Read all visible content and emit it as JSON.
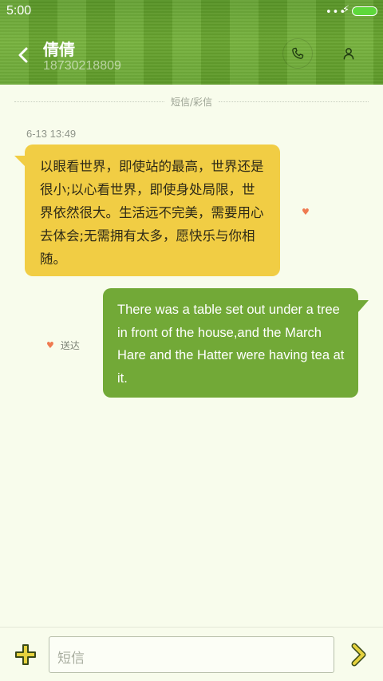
{
  "status_bar": {
    "time": "5:00",
    "dots": "•••",
    "charging_icon": "bolt-icon",
    "battery_color": "#5ed83b"
  },
  "header": {
    "contact_name": "倩倩",
    "contact_number": "18730218809",
    "back_icon": "chevron-left-icon",
    "call_icon": "phone-icon",
    "profile_icon": "person-icon"
  },
  "conversation": {
    "message_type_label": "短信/彩信",
    "timestamp": "6-13 13:49",
    "incoming": {
      "text": "以眼看世界，即使站的最高，世界还是很小;以心看世界，即使身处局限，世界依然很大。生活远不完美，需要用心去体会;无需拥有太多，愿快乐与你相随。",
      "color": "#f1cd44"
    },
    "outgoing": {
      "text": "There was a table set out under a tree in front of the house,and the March Hare and the Hatter were having tea at it.",
      "status": "送达",
      "color": "#72a937"
    },
    "heart_icon": "heart-icon",
    "heart_glyph": "♥"
  },
  "composer": {
    "placeholder": "短信",
    "add_icon": "plus-icon",
    "send_icon": "chevron-right-icon"
  }
}
